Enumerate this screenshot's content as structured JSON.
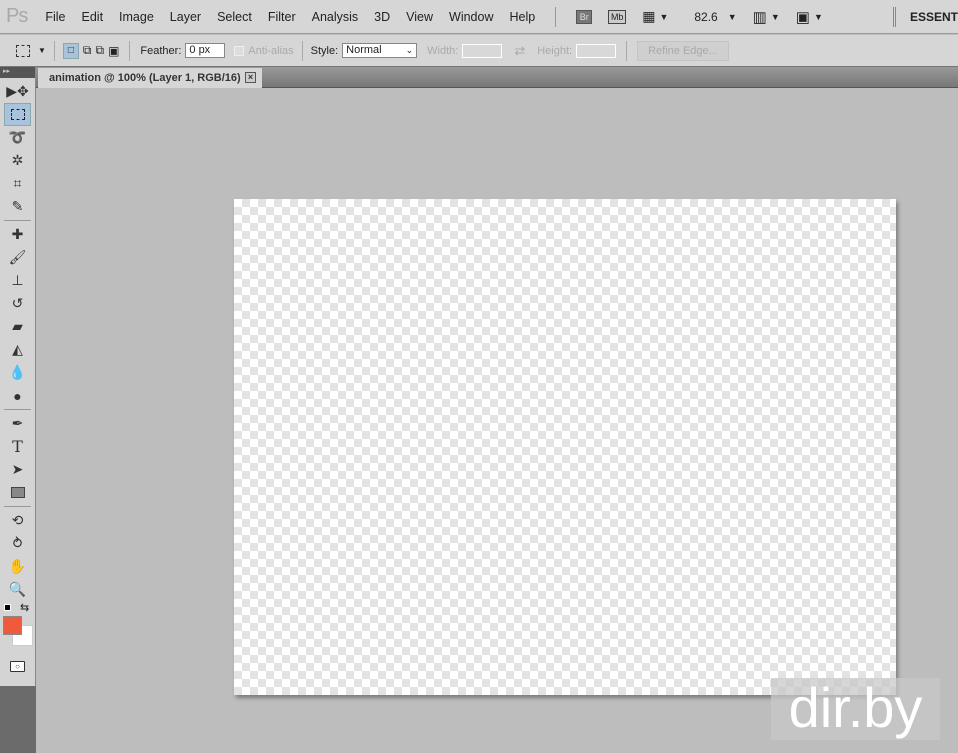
{
  "app": {
    "logo": "Ps",
    "menu": [
      "File",
      "Edit",
      "Image",
      "Layer",
      "Select",
      "Filter",
      "Analysis",
      "3D",
      "View",
      "Window",
      "Help"
    ],
    "bridge": "Br",
    "minibridge": "Mb",
    "zoom": "82.6",
    "workspace": "ESSENTIALS"
  },
  "options": {
    "feather_label": "Feather:",
    "feather_value": "0 px",
    "antialias_label": "Anti-alias",
    "style_label": "Style:",
    "style_value": "Normal",
    "width_label": "Width:",
    "height_label": "Height:",
    "refine_edge": "Refine Edge..."
  },
  "document": {
    "tab_title": "animation @ 100% (Layer 1, RGB/16)",
    "close": "×"
  },
  "colors": {
    "foreground": "#ef5a3c",
    "background": "#ffffff",
    "accent": "#a9c3dd"
  },
  "tools": [
    "move",
    "rectangular-marquee",
    "lasso",
    "quick-selection",
    "crop",
    "eyedropper",
    "spot-healing",
    "brush",
    "clone-stamp",
    "history-brush",
    "eraser",
    "paint-bucket",
    "blur",
    "dodge",
    "pen",
    "type",
    "path-selection",
    "rectangle",
    "3d-rotate",
    "3d-orbit",
    "hand",
    "zoom"
  ],
  "watermark": "dir.by"
}
